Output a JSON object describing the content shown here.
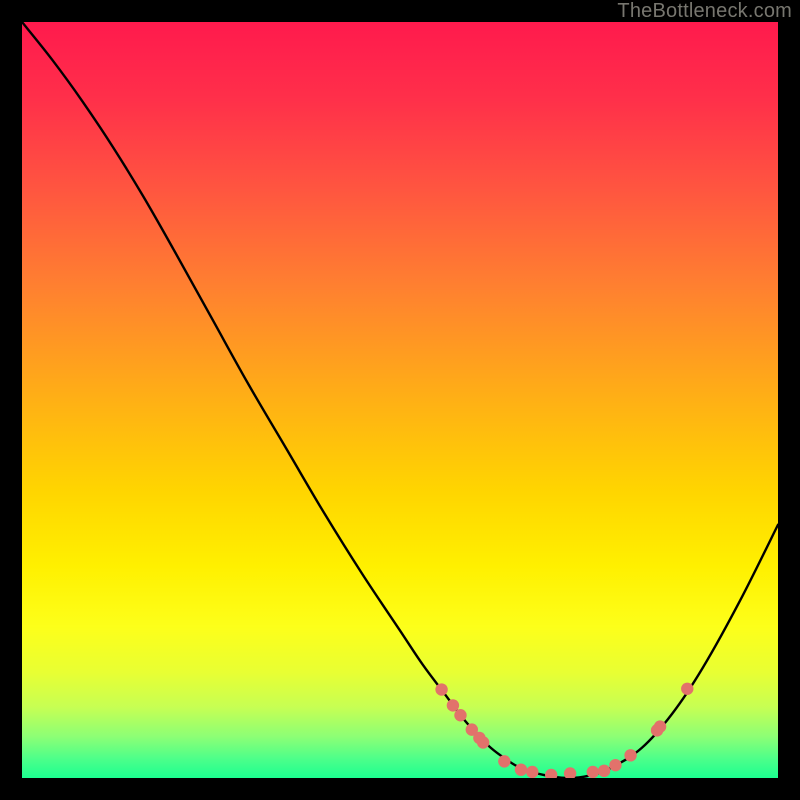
{
  "attribution": "TheBottleneck.com",
  "colors": {
    "gradient_stops": [
      {
        "offset": 0.0,
        "color": "#ff1a4d"
      },
      {
        "offset": 0.1,
        "color": "#ff2f4a"
      },
      {
        "offset": 0.22,
        "color": "#ff5540"
      },
      {
        "offset": 0.35,
        "color": "#ff8030"
      },
      {
        "offset": 0.5,
        "color": "#ffb015"
      },
      {
        "offset": 0.62,
        "color": "#ffd500"
      },
      {
        "offset": 0.72,
        "color": "#fff000"
      },
      {
        "offset": 0.8,
        "color": "#fdff1a"
      },
      {
        "offset": 0.86,
        "color": "#e8ff33"
      },
      {
        "offset": 0.905,
        "color": "#c8ff52"
      },
      {
        "offset": 0.945,
        "color": "#8dff75"
      },
      {
        "offset": 0.975,
        "color": "#4cff8a"
      },
      {
        "offset": 1.0,
        "color": "#1cff90"
      }
    ],
    "curve_stroke": "#000000",
    "marker_fill": "#e2726b",
    "frame": "#000000"
  },
  "chart_data": {
    "type": "line",
    "title": "",
    "xlabel": "",
    "ylabel": "",
    "xlim": [
      0,
      100
    ],
    "ylim": [
      0,
      100
    ],
    "series": [
      {
        "name": "curve",
        "x": [
          0,
          4,
          8,
          12,
          16,
          20,
          25,
          30,
          35,
          40,
          45,
          50,
          53,
          56,
          58,
          60,
          62,
          64,
          66,
          69,
          72,
          75,
          78,
          82,
          86,
          90,
          95,
          100
        ],
        "y": [
          100,
          95,
          89.5,
          83.5,
          77,
          70,
          61,
          52,
          43.5,
          35,
          27,
          19.5,
          15,
          11,
          8.3,
          6,
          4,
          2.5,
          1.3,
          0.4,
          0,
          0.3,
          1.4,
          4,
          8.5,
          14.5,
          23.5,
          33.5
        ]
      }
    ],
    "markers": [
      {
        "x": 55.5,
        "y": 11.7
      },
      {
        "x": 57.0,
        "y": 9.6
      },
      {
        "x": 58.0,
        "y": 8.3
      },
      {
        "x": 59.5,
        "y": 6.4
      },
      {
        "x": 60.5,
        "y": 5.3
      },
      {
        "x": 61.0,
        "y": 4.7
      },
      {
        "x": 63.8,
        "y": 2.2
      },
      {
        "x": 66.0,
        "y": 1.1
      },
      {
        "x": 67.5,
        "y": 0.8
      },
      {
        "x": 70.0,
        "y": 0.4
      },
      {
        "x": 72.5,
        "y": 0.6
      },
      {
        "x": 75.5,
        "y": 0.8
      },
      {
        "x": 77.0,
        "y": 0.95
      },
      {
        "x": 78.5,
        "y": 1.7
      },
      {
        "x": 80.5,
        "y": 3.0
      },
      {
        "x": 84.0,
        "y": 6.3
      },
      {
        "x": 84.4,
        "y": 6.8
      },
      {
        "x": 88.0,
        "y": 11.8
      }
    ]
  }
}
